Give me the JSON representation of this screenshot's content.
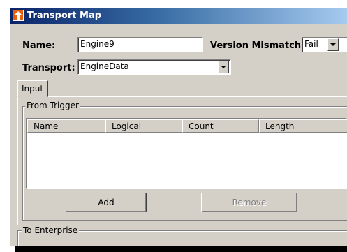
{
  "window": {
    "title": "Transport Map"
  },
  "form": {
    "name_label": "Name:",
    "name_value": "Engine9",
    "version_mismatch_label": "Version Mismatch:",
    "version_mismatch_value": "Fail",
    "transport_label": "Transport:",
    "transport_value": "EngineData"
  },
  "tabs": [
    {
      "label": "Input",
      "selected": true
    }
  ],
  "from_trigger": {
    "title": "From Trigger",
    "columns": [
      "Name",
      "Logical",
      "Count",
      "Length"
    ],
    "rows": [],
    "add_label": "Add",
    "remove_label": "Remove"
  },
  "to_enterprise": {
    "title": "To Enterprise"
  },
  "colors": {
    "titlebar_start": "#0a246a",
    "titlebar_end": "#a6caf0",
    "window_face": "#d4d0c8"
  }
}
